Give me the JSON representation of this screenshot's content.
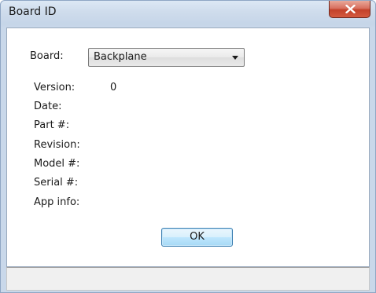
{
  "window": {
    "title": "Board ID",
    "close_icon": "close-icon"
  },
  "form": {
    "board_label": "Board:",
    "board_selected": "Backplane",
    "fields": [
      {
        "label": "Version:",
        "value": "0"
      },
      {
        "label": "Date:",
        "value": ""
      },
      {
        "label": "Part #:",
        "value": ""
      },
      {
        "label": "Revision:",
        "value": ""
      },
      {
        "label": "Model #:",
        "value": ""
      },
      {
        "label": "Serial #:",
        "value": ""
      },
      {
        "label": "App info:",
        "value": ""
      }
    ],
    "ok_label": "OK"
  },
  "colors": {
    "close_button": "#c3422b",
    "ok_button_border": "#3c7fb1",
    "titlebar": "#cfdcec"
  }
}
